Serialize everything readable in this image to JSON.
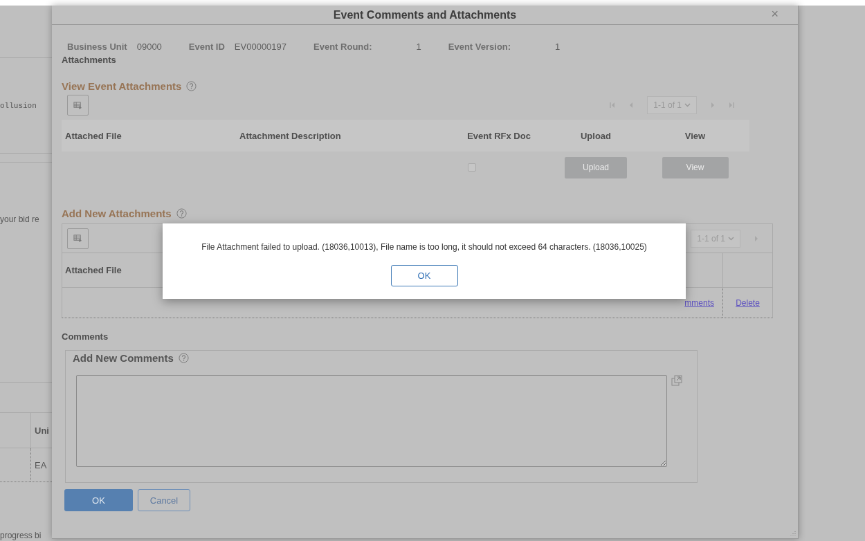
{
  "page_behind": {
    "fragment_top": "ollusion",
    "fragment_middle": "your bid re",
    "table": {
      "column_header": "Uni",
      "cell": "EA"
    },
    "fragment_bottom": "progress bi"
  },
  "dialog": {
    "title": "Event Comments and Attachments",
    "close": "×",
    "header_fields": [
      {
        "label": "Business Unit",
        "value": "09000"
      },
      {
        "label": "Event ID",
        "value": "EV00000197"
      },
      {
        "label": "Event Round:",
        "value": "1"
      },
      {
        "label": "Event Version:",
        "value": "1"
      }
    ],
    "attachments_heading": "Attachments",
    "view_section": {
      "title": "View Event Attachments",
      "pager": "1-1 of 1",
      "columns": [
        "Attached File",
        "Attachment Description",
        "Event RFx Doc",
        "Upload",
        "View"
      ],
      "rows": [
        {
          "event_rfx_doc": {
            "checked": false,
            "disabled": true
          },
          "upload": {
            "label": "Upload",
            "disabled": true
          },
          "view": {
            "label": "View",
            "disabled": true
          }
        }
      ]
    },
    "add_section": {
      "title": "Add New Attachments",
      "pager": "1-1 of 1",
      "columns": [
        "Attached File"
      ],
      "rows": [
        {
          "comments_link": "mments",
          "delete_link": "Delete"
        }
      ]
    },
    "comments": {
      "heading": "Comments",
      "legend": "Add New Comments"
    },
    "buttons": [
      {
        "label": "OK",
        "kind": "primary"
      },
      {
        "label": "Cancel",
        "kind": "secondary"
      }
    ]
  },
  "alert": {
    "message": "File Attachment failed to upload. (18036,10013), File name is too long, it should not exceed 64 characters. (18036,10025)",
    "button": "OK"
  }
}
